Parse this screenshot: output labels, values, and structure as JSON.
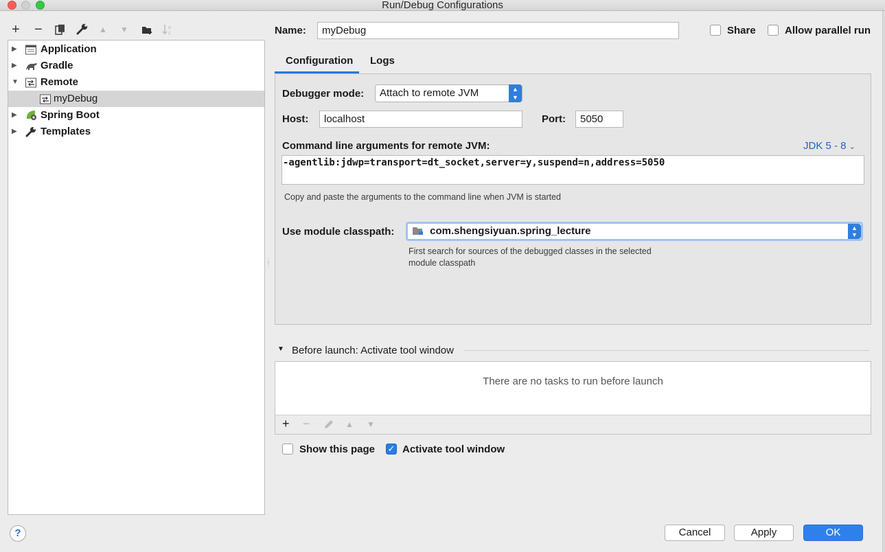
{
  "window": {
    "title": "Run/Debug Configurations"
  },
  "left_toolbar": {
    "add": "+",
    "remove": "−",
    "copy_icon": "copy-icon",
    "wrench_icon": "wrench-icon",
    "move_up": "▲",
    "move_down": "▼",
    "folder_icon": "folder-icon",
    "sort_icon": "sort-icon"
  },
  "tree": {
    "items": [
      {
        "label": "Application",
        "expanded": false
      },
      {
        "label": "Gradle",
        "expanded": false
      },
      {
        "label": "Remote",
        "expanded": true
      },
      {
        "label": "myDebug",
        "selected": true
      },
      {
        "label": "Spring Boot",
        "expanded": false
      },
      {
        "label": "Templates",
        "expanded": false
      }
    ]
  },
  "header": {
    "name_label": "Name:",
    "name_value": "myDebug",
    "share_label": "Share",
    "share_checked": false,
    "parallel_label": "Allow parallel run",
    "parallel_checked": false
  },
  "tabs": [
    {
      "label": "Configuration",
      "active": true
    },
    {
      "label": "Logs",
      "active": false
    }
  ],
  "config": {
    "debugger_mode_label": "Debugger mode:",
    "debugger_mode_value": "Attach to remote JVM",
    "host_label": "Host:",
    "host_value": "localhost",
    "port_label": "Port:",
    "port_value": "5050",
    "cmd_label": "Command line arguments for remote JVM:",
    "jdk_link": "JDK 5 - 8",
    "cmd_value": "-agentlib:jdwp=transport=dt_socket,server=y,suspend=n,address=5050",
    "cmd_hint": "Copy and paste the arguments to the command line when JVM is started",
    "classpath_label": "Use module classpath:",
    "classpath_value": "com.shengsiyuan.spring_lecture",
    "classpath_hint_1": "First search for sources of the debugged classes in the selected",
    "classpath_hint_2": "module classpath"
  },
  "before_launch": {
    "title": "Before launch: Activate tool window",
    "empty_text": "There are no tasks to run before launch",
    "add": "+",
    "remove": "−",
    "up": "▲",
    "down": "▼"
  },
  "options": {
    "show_page_label": "Show this page",
    "show_page_checked": false,
    "activate_label": "Activate tool window",
    "activate_checked": true
  },
  "footer": {
    "help": "?",
    "cancel": "Cancel",
    "apply": "Apply",
    "ok": "OK"
  },
  "colors": {
    "accent": "#2f80ed",
    "selection": "#d5d5d5",
    "link": "#2463c7"
  }
}
